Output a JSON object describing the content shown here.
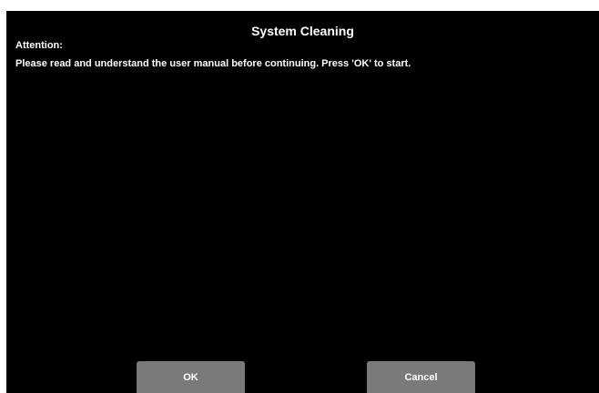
{
  "dialog": {
    "title": "System Cleaning",
    "attention_label": "Attention:",
    "message": "Please read and understand the user manual before continuing. Press 'OK' to start."
  },
  "buttons": {
    "ok_label": "OK",
    "cancel_label": "Cancel"
  },
  "colors": {
    "background": "#000000",
    "text": "#ffffff",
    "button_bg": "#7a7a7a"
  }
}
